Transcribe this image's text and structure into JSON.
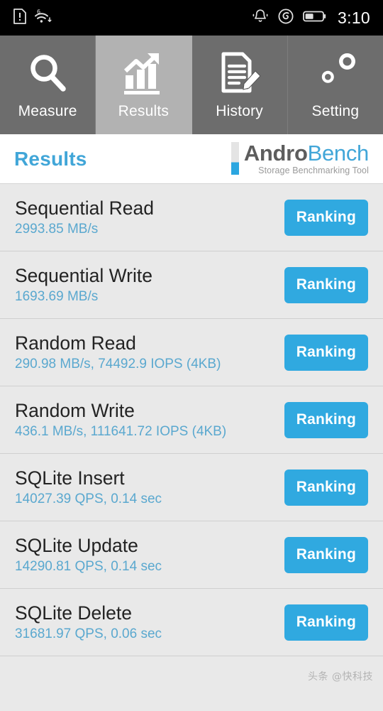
{
  "statusbar": {
    "time": "3:10",
    "left_icons": [
      {
        "name": "sim-card-alert-icon",
        "glyph": "sim"
      },
      {
        "name": "wifi-6-icon",
        "glyph": "wifi",
        "badge": "6"
      }
    ],
    "right_icons": [
      {
        "name": "notification-bell-icon",
        "glyph": "bell"
      },
      {
        "name": "app-spiral-icon",
        "glyph": "spiral"
      },
      {
        "name": "battery-icon",
        "glyph": "battery"
      }
    ]
  },
  "tabs": [
    {
      "label": "Measure",
      "icon": "magnifier-icon",
      "active": false
    },
    {
      "label": "Results",
      "icon": "bar-chart-arrow-icon",
      "active": true
    },
    {
      "label": "History",
      "icon": "document-pencil-icon",
      "active": false
    },
    {
      "label": "Setting",
      "icon": "gears-icon",
      "active": false
    }
  ],
  "header": {
    "title": "Results",
    "brand_part1": "Andro",
    "brand_part2": "Bench",
    "brand_subtitle": "Storage Benchmarking Tool"
  },
  "colors": {
    "accent_blue": "#30a9e0",
    "title_blue": "#41a6d8",
    "value_blue": "#5aa8cf",
    "tab_inactive": "#6d6d6d",
    "tab_active": "#b2b2b2",
    "row_bg": "#e9e9e9",
    "statusbar_bg": "#000000"
  },
  "results": [
    {
      "name": "Sequential Read",
      "value": "2993.85 MB/s",
      "button": "Ranking"
    },
    {
      "name": "Sequential Write",
      "value": "1693.69 MB/s",
      "button": "Ranking"
    },
    {
      "name": "Random Read",
      "value": "290.98 MB/s, 74492.9 IOPS (4KB)",
      "button": "Ranking"
    },
    {
      "name": "Random Write",
      "value": "436.1 MB/s, 111641.72 IOPS (4KB)",
      "button": "Ranking"
    },
    {
      "name": "SQLite Insert",
      "value": "14027.39 QPS, 0.14 sec",
      "button": "Ranking"
    },
    {
      "name": "SQLite Update",
      "value": "14290.81 QPS, 0.14 sec",
      "button": "Ranking"
    },
    {
      "name": "SQLite Delete",
      "value": "31681.97 QPS, 0.06 sec",
      "button": "Ranking"
    }
  ],
  "watermark": "头条 @快科技"
}
